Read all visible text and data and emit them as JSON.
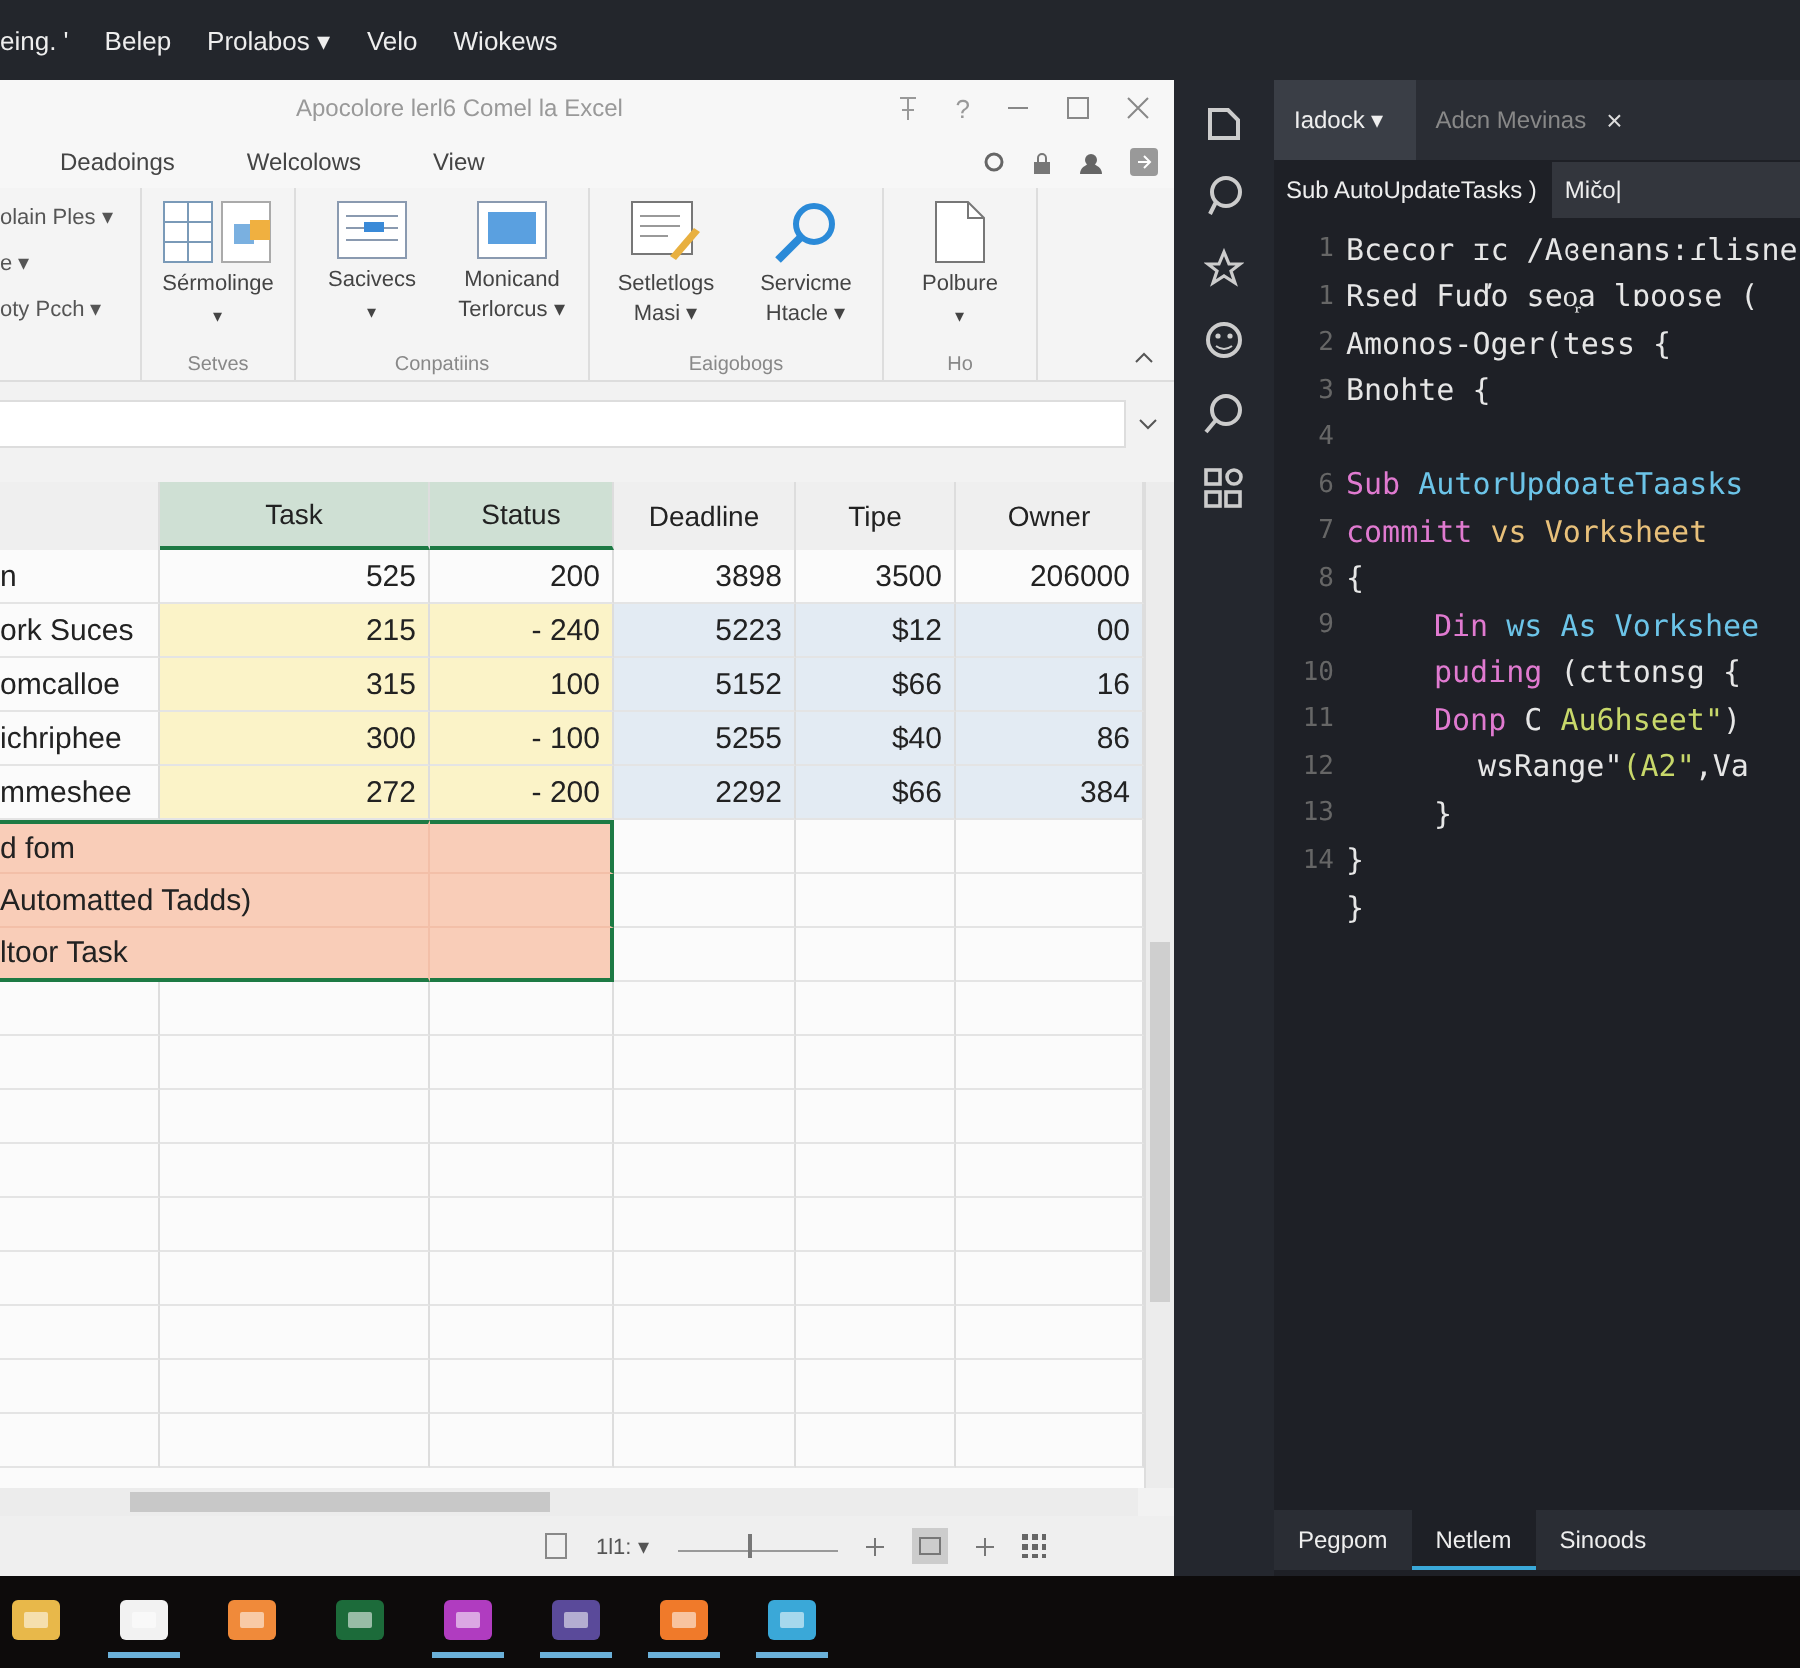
{
  "menu_bar": [
    "eing. '",
    "Belep",
    "Prolabos ▾",
    "Velo",
    "Wiokews"
  ],
  "excel": {
    "title": "Apocolore lerl6 Comel la Excel",
    "help_label": "?",
    "ribbon_tabs": [
      {
        "label": "Deadoings",
        "selected": false
      },
      {
        "label": "Welcolows",
        "selected": false
      },
      {
        "label": "View",
        "selected": false
      }
    ],
    "left_group": [
      "olain Ples ▾",
      "e ▾",
      "oty Pcch ▾"
    ],
    "groups": [
      {
        "label": "Setves",
        "buttons": [
          {
            "kind": "grid",
            "label": "Sérmolinge",
            "caret": "▾"
          }
        ]
      },
      {
        "label": "Conpatiins",
        "buttons": [
          {
            "kind": "list",
            "label": "Sacivecs",
            "caret": "▾"
          },
          {
            "kind": "panel",
            "label": "Monicand Terlorcus ▾"
          }
        ]
      },
      {
        "label": "Eaigobogs",
        "buttons": [
          {
            "kind": "edit",
            "label": "Setletlogs Masi ▾"
          },
          {
            "kind": "search",
            "label": "Servicme Htacle ▾"
          }
        ]
      },
      {
        "label": "Ho",
        "buttons": [
          {
            "kind": "doc",
            "label": "Polbure",
            "caret": "▾"
          }
        ]
      }
    ],
    "columns": [
      {
        "selected": false
      },
      {
        "label": "Task",
        "selected": true
      },
      {
        "label": "Status",
        "selected": true
      },
      {
        "label": "Deadline",
        "selected": false
      },
      {
        "label": "Tipe",
        "selected": false
      },
      {
        "label": "Owner",
        "selected": false
      }
    ],
    "rows": [
      {
        "highlighted": false,
        "selected": false,
        "cells": [
          "n",
          "525",
          "200",
          "3898",
          "3500",
          "206000"
        ]
      },
      {
        "highlighted": true,
        "selected": false,
        "cells": [
          "ork Suces",
          "215",
          "- 240",
          "5223",
          "$12",
          "00"
        ]
      },
      {
        "highlighted": true,
        "selected": false,
        "cells": [
          "omcalloe",
          "315",
          "100",
          "5152",
          "$66",
          "16"
        ]
      },
      {
        "highlighted": true,
        "selected": false,
        "cells": [
          "ichriphee",
          "300",
          "- 100",
          "5255",
          "$40",
          "86"
        ]
      },
      {
        "highlighted": true,
        "selected": false,
        "cells": [
          "mmeshee",
          "272",
          "- 200",
          "2292",
          "$66",
          "384"
        ]
      },
      {
        "highlighted": false,
        "selected": true,
        "cells": [
          "d fom",
          "",
          "",
          "",
          "",
          ""
        ]
      },
      {
        "highlighted": false,
        "selected": true,
        "cells": [
          "Automatted Tadds)",
          "",
          "",
          "",
          "",
          ""
        ]
      },
      {
        "highlighted": false,
        "selected": true,
        "cells": [
          "ltoor Task",
          "",
          "",
          "",
          "",
          ""
        ]
      }
    ],
    "status_text": "1l1: ▾",
    "zoom": {
      "level": 0.45
    }
  },
  "editor": {
    "tabs": [
      {
        "label": "Iadock ▾",
        "selected": true,
        "closable": false
      },
      {
        "label": "Adcn Mevinas",
        "selected": false,
        "closable": true,
        "close_label": "×"
      }
    ],
    "breadcrumb": "Sub AutoUpdateTasks )",
    "search_value": "Mičo|",
    "lines": [
      {
        "number": "1",
        "tokens": [
          {
            "kind": "plain",
            "text": "Bcecor ɪc /Aɞenans:ɾlisne"
          }
        ]
      },
      {
        "number": "1",
        "tokens": [
          {
            "kind": "plain",
            "text": "Rsed Fuďo seo᷊a lɒoose ("
          }
        ]
      },
      {
        "number": "2",
        "tokens": [
          {
            "kind": "plain",
            "text": "Amonos-Oger(tess {"
          }
        ]
      },
      {
        "number": "3",
        "tokens": [
          {
            "kind": "plain",
            "text": "Bnohte {"
          }
        ]
      },
      {
        "number": "4"
      },
      {
        "number": "6",
        "tokens": [
          {
            "kind": "keyword",
            "text": "Sub "
          },
          {
            "kind": "function",
            "text": "AutorUpdoateTaasks"
          }
        ]
      },
      {
        "number": "7",
        "tokens": [
          {
            "kind": "keyword",
            "text": "committ "
          },
          {
            "kind": "type",
            "text": "vs Vorksheet"
          }
        ]
      },
      {
        "number": "8",
        "tokens": [
          {
            "kind": "plain",
            "text": "{"
          }
        ],
        "children": [
          {
            "number": "9",
            "tokens": [
              {
                "kind": "keyword",
                "text": "Din  "
              },
              {
                "kind": "function",
                "text": "ws As Vorkshee"
              }
            ]
          },
          {
            "number": "10",
            "tokens": [
              {
                "kind": "keyword",
                "text": "puding "
              },
              {
                "kind": "plain",
                "text": "(cttonsg {"
              }
            ]
          },
          {
            "number": "11",
            "tokens": [
              {
                "kind": "keyword",
                "text": "Donp "
              },
              {
                "kind": "plain",
                "text": "C "
              },
              {
                "kind": "string",
                "text": "Au6hseet\""
              },
              {
                "kind": "plain",
                "text": ")"
              }
            ],
            "children": [
              {
                "number": "12",
                "tokens": [
                  {
                    "kind": "plain",
                    "text": "wsRange\""
                  },
                  {
                    "kind": "string",
                    "text": "(A2\""
                  },
                  {
                    "kind": "plain",
                    "text": ",Va"
                  }
                ]
              }
            ]
          },
          {
            "number": "13",
            "tokens": [
              {
                "kind": "plain",
                "text": "}"
              }
            ]
          }
        ]
      },
      {
        "number": "14",
        "tokens": [
          {
            "kind": "plain",
            "text": "}"
          }
        ]
      },
      {
        "tokens": [
          {
            "kind": "plain",
            "text": "}"
          }
        ]
      }
    ],
    "panel_tabs": [
      {
        "label": "Pegpom",
        "selected": false
      },
      {
        "label": "Netlem",
        "selected": true
      },
      {
        "label": "Sinoods",
        "selected": false
      }
    ]
  },
  "taskbar": [
    {
      "kind": "folder",
      "running": false
    },
    {
      "kind": "bag",
      "running": true
    },
    {
      "kind": "files",
      "running": false
    },
    {
      "kind": "terminal",
      "running": false
    },
    {
      "kind": "purple",
      "running": true
    },
    {
      "kind": "slate",
      "running": true
    },
    {
      "kind": "orange",
      "running": true
    },
    {
      "kind": "bird",
      "running": true
    }
  ]
}
